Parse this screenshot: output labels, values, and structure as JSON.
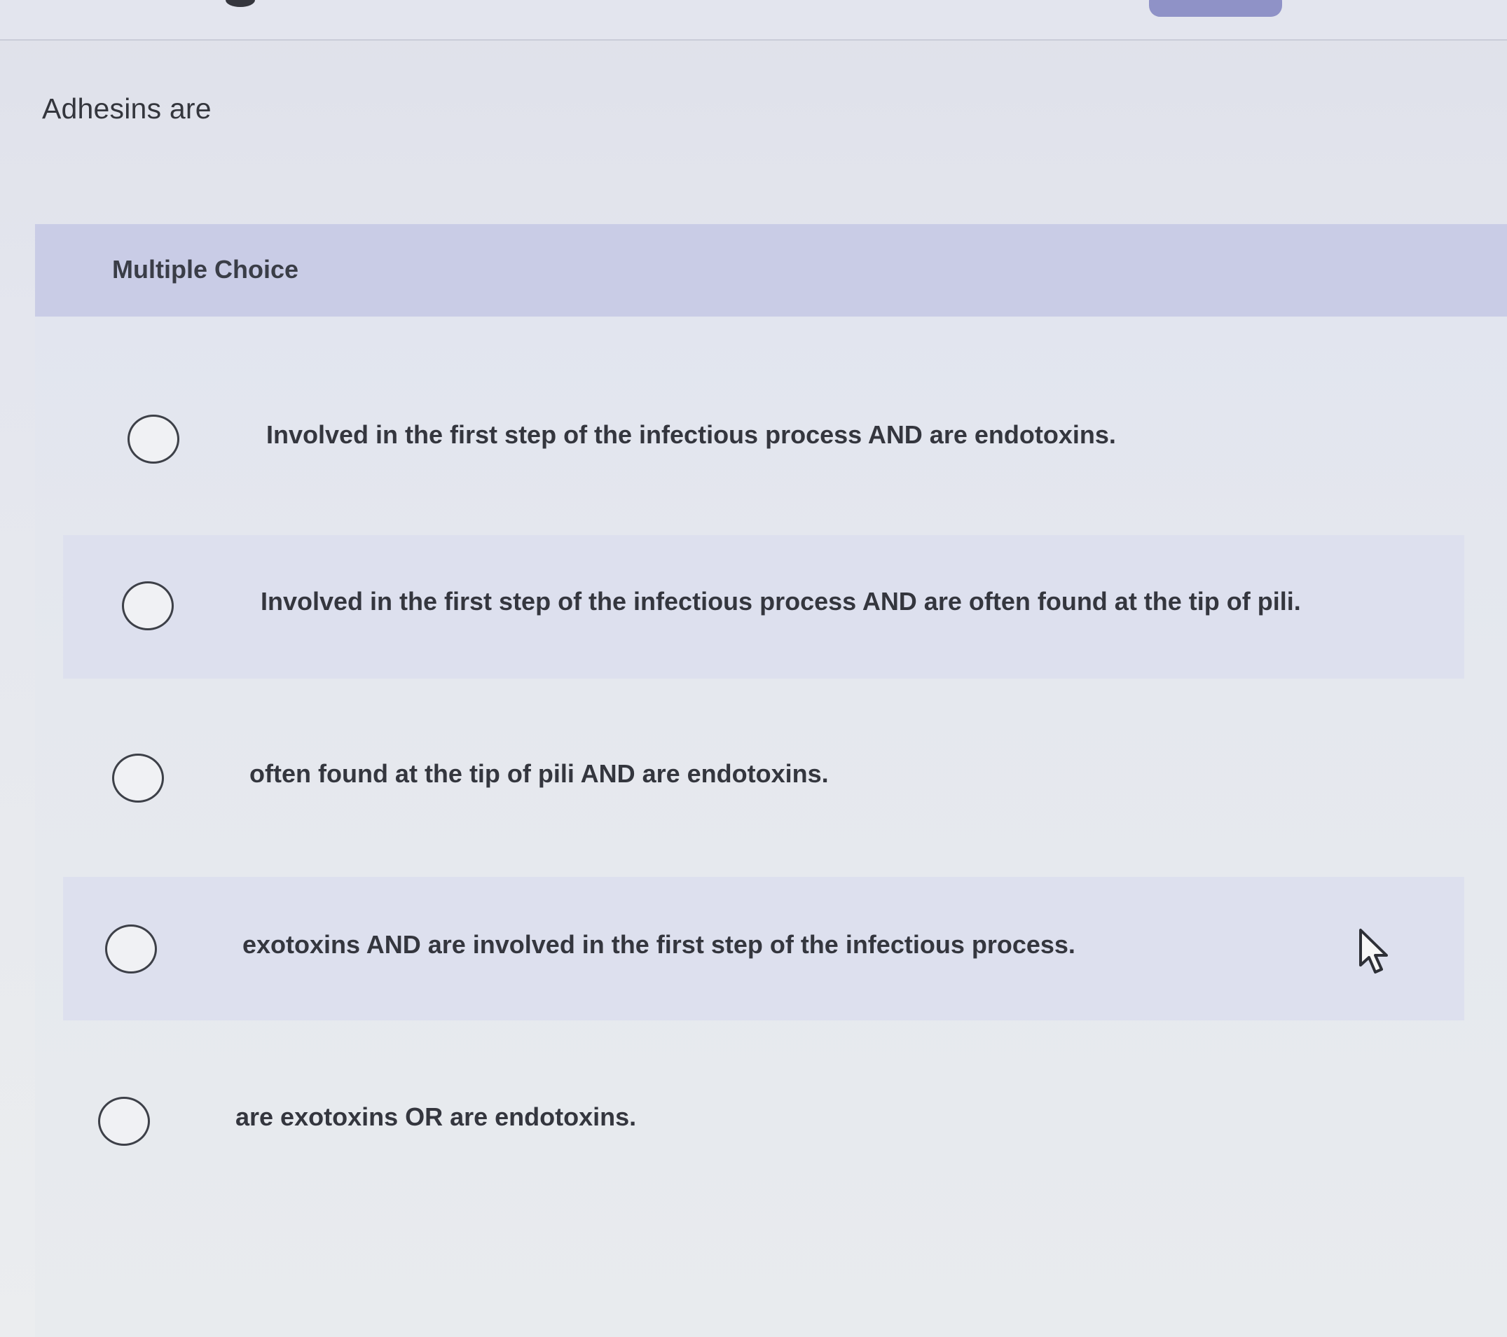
{
  "question": {
    "text": "Adhesins are"
  },
  "section": {
    "label": "Multiple Choice"
  },
  "choices": [
    {
      "text": "Involved in the first step of the infectious process AND are endotoxins."
    },
    {
      "text": "Involved in the first step of the infectious process AND are often found at the tip of pili."
    },
    {
      "text": "often found at the tip of pili AND are endotoxins."
    },
    {
      "text": "exotoxins AND are involved in the first step of the infectious process."
    },
    {
      "text": "are exotoxins OR are endotoxins."
    }
  ],
  "colors": {
    "header_band": "#c9cce6",
    "top_button": "#8f92c7",
    "text": "#34363e"
  },
  "icons": {
    "radio": "radio-unchecked-icon",
    "pointer": "mouse-pointer-icon"
  }
}
